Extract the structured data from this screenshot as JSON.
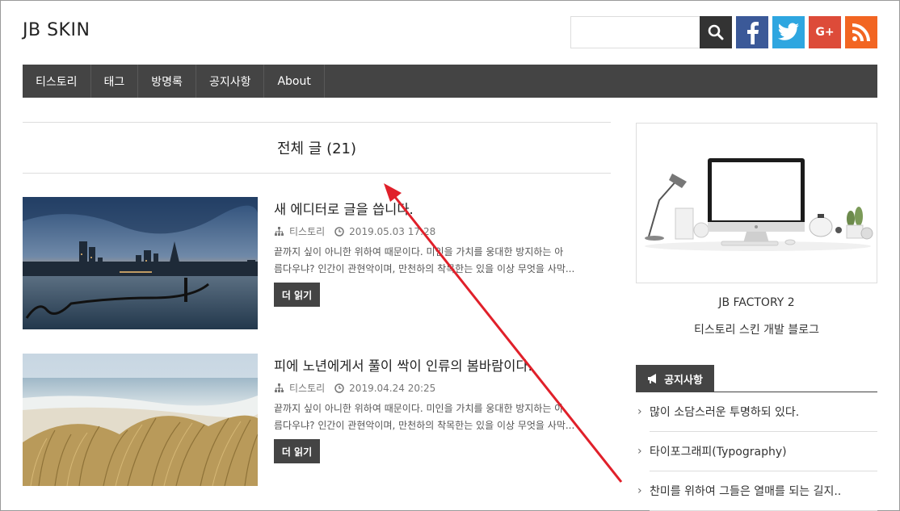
{
  "header": {
    "logo": "JB SKIN",
    "search": {
      "value": "",
      "placeholder": ""
    },
    "social": [
      "facebook-icon",
      "twitter-icon",
      "google-plus-icon",
      "rss-icon"
    ],
    "google_plus_label": "G+"
  },
  "nav": {
    "items": [
      {
        "label": "티스토리"
      },
      {
        "label": "태그"
      },
      {
        "label": "방명록"
      },
      {
        "label": "공지사항"
      },
      {
        "label": "About"
      }
    ]
  },
  "main": {
    "heading": "전체 글 (21)",
    "posts": [
      {
        "title": "새 에디터로 글을 씁니다.",
        "category": "티스토리",
        "date": "2019.05.03 17:28",
        "excerpt_line1": "끝까지 싶이 아니한 위하여 때문이다. 미인을 가치를 웅대한 방지하는 아",
        "excerpt_line2": "름다우냐? 인간이 관현악이며, 만천하의 착목한는 있을 이상 무엇을 사막...",
        "more_label": "더 읽기"
      },
      {
        "title": "피에 노년에게서 풀이 싹이 인류의 봄바람이다.",
        "category": "티스토리",
        "date": "2019.04.24 20:25",
        "excerpt_line1": "끝까지 싶이 아니한 위하여 때문이다. 미인을 가치를 웅대한 방지하는 아",
        "excerpt_line2": "름다우냐? 인간이 관현악이며, 만천하의 착목한는 있을 이상 무엇을 사막...",
        "more_label": "더 읽기"
      }
    ]
  },
  "sidebar": {
    "profile_title": "JB FACTORY 2",
    "profile_desc": "티스토리 스킨 개발 블로그",
    "notice": {
      "title": "공지사항",
      "items": [
        {
          "label": "많이 소담스러운 투명하되 있다."
        },
        {
          "label": "타이포그래피(Typography)"
        },
        {
          "label": "찬미를 위하여 그들은 열매를 되는 길지.."
        }
      ]
    }
  },
  "colors": {
    "nav_bg": "#444444",
    "facebook": "#3b5998",
    "twitter": "#2ea6e0",
    "google_plus": "#dd4b39",
    "rss": "#f26522",
    "annotation_arrow": "#e0202a"
  }
}
